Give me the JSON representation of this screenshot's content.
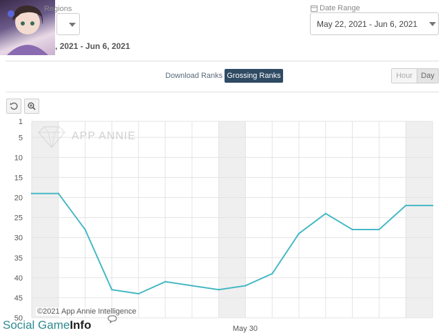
{
  "filters": {
    "regions_label": "Regions",
    "date_range_label": "Date Range",
    "date_range_value": "May 22, 2021 - Jun 6, 2021",
    "subtitle_date": "May 22, 2021 - Jun 6, 2021"
  },
  "toolbar": {
    "download_ranks": "Download Ranks",
    "grossing_ranks": "Grossing Ranks",
    "hour": "Hour",
    "day": "Day"
  },
  "watermarks": {
    "app_annie": "APP ANNIE",
    "copyright": "©2021 App Annie Intelligence",
    "social_game_1": "Social Game",
    "social_game_2": "Info"
  },
  "colors": {
    "line": "#45b8c4",
    "weekend_band": "#efefef",
    "active_button": "#2f4a63"
  },
  "chart_data": {
    "type": "line",
    "title": "",
    "xlabel": "",
    "ylabel": "",
    "y_inverted": true,
    "ylim": [
      1,
      50
    ],
    "y_ticks": [
      1,
      5,
      10,
      15,
      20,
      25,
      30,
      35,
      40,
      45,
      50
    ],
    "x_tick_labels": [
      {
        "label": "May 30",
        "index": 8
      }
    ],
    "x": [
      "2021-05-22",
      "2021-05-23",
      "2021-05-24",
      "2021-05-25",
      "2021-05-26",
      "2021-05-27",
      "2021-05-28",
      "2021-05-29",
      "2021-05-30",
      "2021-05-31",
      "2021-06-01",
      "2021-06-02",
      "2021-06-03",
      "2021-06-04",
      "2021-06-05",
      "2021-06-06"
    ],
    "series": [
      {
        "values": [
          19,
          19,
          28,
          43,
          44,
          41,
          42,
          43,
          42,
          39,
          29,
          24,
          28,
          28,
          22,
          22
        ]
      }
    ],
    "weekend_bands": [
      [
        0,
        1
      ],
      [
        7,
        8
      ],
      [
        14,
        15
      ]
    ],
    "grid": true
  }
}
